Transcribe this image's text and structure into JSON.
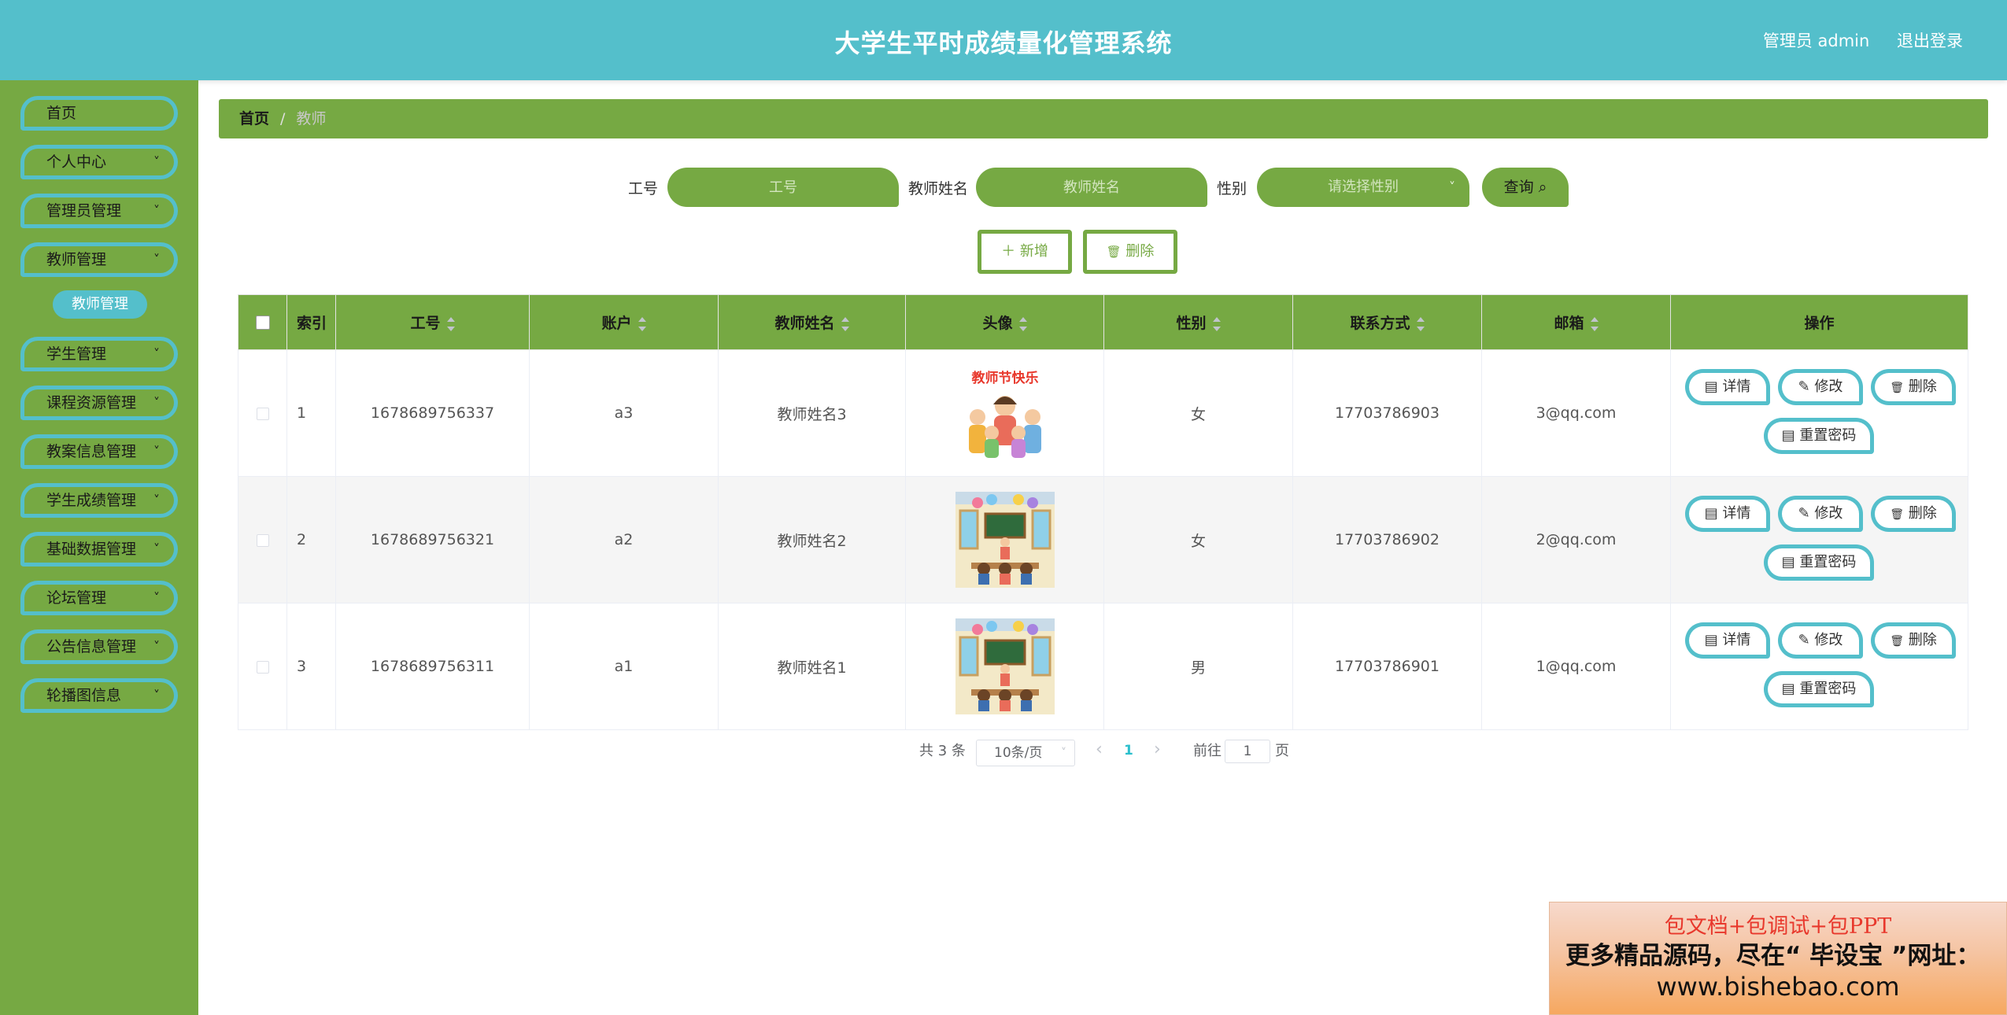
{
  "header": {
    "title": "大学生平时成绩量化管理系统",
    "user_label": "管理员 admin",
    "logout_label": "退出登录"
  },
  "sidebar": {
    "items": [
      {
        "label": "首页",
        "has_submenu": false
      },
      {
        "label": "个人中心",
        "has_submenu": true
      },
      {
        "label": "管理员管理",
        "has_submenu": true
      },
      {
        "label": "教师管理",
        "has_submenu": true
      },
      {
        "label": "学生管理",
        "has_submenu": true
      },
      {
        "label": "课程资源管理",
        "has_submenu": true
      },
      {
        "label": "教案信息管理",
        "has_submenu": true
      },
      {
        "label": "学生成绩管理",
        "has_submenu": true
      },
      {
        "label": "基础数据管理",
        "has_submenu": true
      },
      {
        "label": "论坛管理",
        "has_submenu": true
      },
      {
        "label": "公告信息管理",
        "has_submenu": true
      },
      {
        "label": "轮播图信息",
        "has_submenu": true
      }
    ],
    "active_submenu": "教师管理",
    "chevron": "˅"
  },
  "breadcrumb": {
    "home": "首页",
    "separator": "/",
    "current": "教师"
  },
  "search": {
    "job_no_label": "工号",
    "job_no_placeholder": "工号",
    "name_label": "教师姓名",
    "name_placeholder": "教师姓名",
    "gender_label": "性别",
    "gender_placeholder": "请选择性别",
    "query_label": "查询",
    "query_icon": "⌕"
  },
  "actions": {
    "add_label": "新增",
    "add_icon": "＋",
    "delete_label": "删除",
    "delete_icon": "🗑"
  },
  "table": {
    "columns": [
      "索引",
      "工号",
      "账户",
      "教师姓名",
      "头像",
      "性别",
      "联系方式",
      "邮箱",
      "操作"
    ],
    "rows": [
      {
        "index": "1",
        "job_no": "1678689756337",
        "account": "a3",
        "name": "教师姓名3",
        "avatar": "teachers-day-picture",
        "avatar_text": "教师节快乐",
        "gender": "女",
        "phone": "17703786903",
        "email": "3@qq.com"
      },
      {
        "index": "2",
        "job_no": "1678689756321",
        "account": "a2",
        "name": "教师姓名2",
        "avatar": "classroom-picture",
        "avatar_text": "",
        "gender": "女",
        "phone": "17703786902",
        "email": "2@qq.com"
      },
      {
        "index": "3",
        "job_no": "1678689756311",
        "account": "a1",
        "name": "教师姓名1",
        "avatar": "classroom-picture",
        "avatar_text": "",
        "gender": "男",
        "phone": "17703786901",
        "email": "1@qq.com"
      }
    ],
    "row_actions": {
      "detail": "详情",
      "edit": "修改",
      "delete": "删除",
      "reset": "重置密码"
    }
  },
  "pagination": {
    "total_text": "共 3 条",
    "page_size": "10条/页",
    "current_page": "1",
    "goto_prefix": "前往",
    "goto_value": "1",
    "goto_suffix": "页"
  },
  "ad": {
    "line1": "包文档+包调试+包PPT",
    "line2": "更多精品源码，尽在“ 毕设宝 ”网址：",
    "line3": "www.bishebao.com"
  },
  "colors": {
    "header": "#54bfcb",
    "primary_green": "#76a943",
    "accent_cyan": "#54bfcb",
    "page_number": "#2bbfcc"
  }
}
